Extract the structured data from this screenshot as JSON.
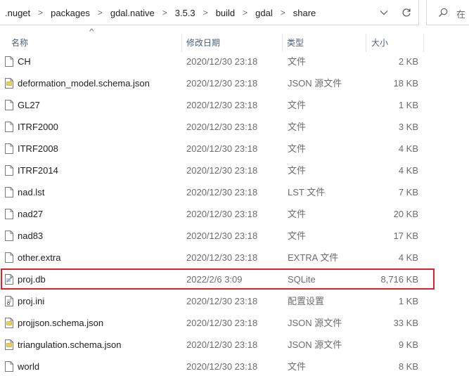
{
  "breadcrumb": [
    ".nuget",
    "packages",
    "gdal.native",
    "3.5.3",
    "build",
    "gdal",
    "share"
  ],
  "breadcrumb_separator": ">",
  "search": {
    "placeholder": "在"
  },
  "columns": {
    "name": "名称",
    "date": "修改日期",
    "type": "类型",
    "size": "大小"
  },
  "files": [
    {
      "name": "CH",
      "date": "2020/12/30 23:18",
      "type": "文件",
      "size": "2 KB",
      "icon": "blank-file-icon"
    },
    {
      "name": "deformation_model.schema.json",
      "date": "2020/12/30 23:18",
      "type": "JSON 源文件",
      "size": "18 KB",
      "icon": "json-file-icon"
    },
    {
      "name": "GL27",
      "date": "2020/12/30 23:18",
      "type": "文件",
      "size": "1 KB",
      "icon": "blank-file-icon"
    },
    {
      "name": "ITRF2000",
      "date": "2020/12/30 23:18",
      "type": "文件",
      "size": "3 KB",
      "icon": "blank-file-icon"
    },
    {
      "name": "ITRF2008",
      "date": "2020/12/30 23:18",
      "type": "文件",
      "size": "4 KB",
      "icon": "blank-file-icon"
    },
    {
      "name": "ITRF2014",
      "date": "2020/12/30 23:18",
      "type": "文件",
      "size": "4 KB",
      "icon": "blank-file-icon"
    },
    {
      "name": "nad.lst",
      "date": "2020/12/30 23:18",
      "type": "LST 文件",
      "size": "7 KB",
      "icon": "blank-file-icon"
    },
    {
      "name": "nad27",
      "date": "2020/12/30 23:18",
      "type": "文件",
      "size": "20 KB",
      "icon": "blank-file-icon"
    },
    {
      "name": "nad83",
      "date": "2020/12/30 23:18",
      "type": "文件",
      "size": "17 KB",
      "icon": "blank-file-icon"
    },
    {
      "name": "other.extra",
      "date": "2020/12/30 23:18",
      "type": "EXTRA 文件",
      "size": "4 KB",
      "icon": "blank-file-icon"
    },
    {
      "name": "proj.db",
      "date": "2022/2/6 3:09",
      "type": "SQLite",
      "size": "8,716 KB",
      "icon": "sqlite-file-icon"
    },
    {
      "name": "proj.ini",
      "date": "2020/12/30 23:18",
      "type": "配置设置",
      "size": "1 KB",
      "icon": "ini-file-icon"
    },
    {
      "name": "projjson.schema.json",
      "date": "2020/12/30 23:18",
      "type": "JSON 源文件",
      "size": "33 KB",
      "icon": "json-file-icon"
    },
    {
      "name": "triangulation.schema.json",
      "date": "2020/12/30 23:18",
      "type": "JSON 源文件",
      "size": "9 KB",
      "icon": "json-file-icon"
    },
    {
      "name": "world",
      "date": "2020/12/30 23:18",
      "type": "文件",
      "size": "8 KB",
      "icon": "blank-file-icon"
    }
  ],
  "colors": {
    "highlight": "#e0202a",
    "header_text": "#4c607a",
    "detail_text": "#6d6d6d"
  }
}
